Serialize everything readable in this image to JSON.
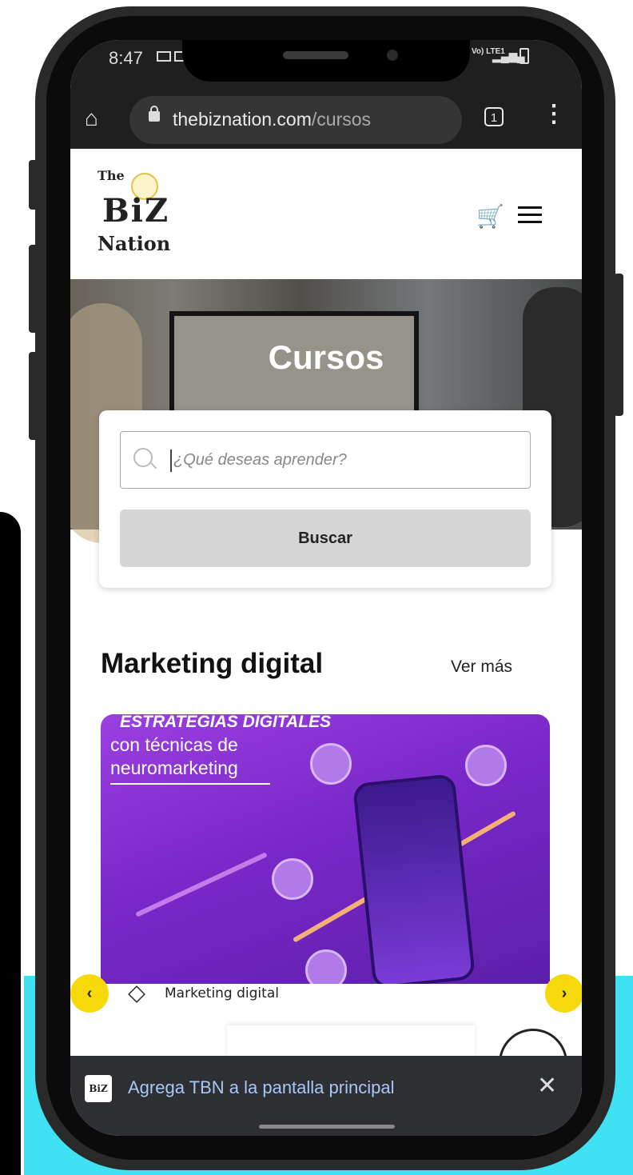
{
  "status_bar": {
    "time": "8:47",
    "network": "Vo) LTE1"
  },
  "browser": {
    "url_domain": "thebiznation.com",
    "url_path": "/cursos",
    "tab_count": "1"
  },
  "site_header": {
    "logo_the": "The",
    "logo_biz": "BiZ",
    "logo_nation": "Nation"
  },
  "hero": {
    "title": "Cursos"
  },
  "search": {
    "placeholder": "¿Qué deseas aprender?",
    "button_label": "Buscar"
  },
  "section": {
    "title": "Marketing digital",
    "see_more": "Ver más"
  },
  "course_card": {
    "headline": "ESTRATEGIAS DIGITALES",
    "subline": "con técnicas de neuromarketing",
    "category": "Marketing digital"
  },
  "install_banner": {
    "logo_text": "BiZ",
    "message": "Agrega TBN a la pantalla principal"
  },
  "colors": {
    "accent_yellow": "#f5d90a",
    "card_purple": "#7a28c9",
    "background_cyan": "#3fe1f3"
  }
}
